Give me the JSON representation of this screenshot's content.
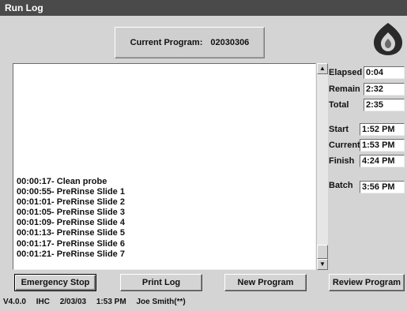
{
  "window": {
    "title": "Run Log"
  },
  "program": {
    "label": "Current Program:",
    "value": "02030306"
  },
  "logo": {
    "icon": "flame-logo-icon"
  },
  "log": {
    "lines": [
      "00:00:17- Clean probe",
      "00:00:55- PreRinse Slide 1",
      "00:01:01- PreRinse Slide 2",
      "00:01:05- PreRinse Slide 3",
      "00:01:09- PreRinse Slide 4",
      "00:01:13- PreRinse Slide 5",
      "00:01:17- PreRinse Slide 6",
      "00:01:21- PreRinse Slide 7"
    ]
  },
  "timing": {
    "elapsed": {
      "label": "Elapsed",
      "value": "0:04"
    },
    "remain": {
      "label": "Remain",
      "value": "2:32"
    },
    "total": {
      "label": "Total",
      "value": "2:35"
    },
    "start": {
      "label": "Start",
      "value": "1:52 PM"
    },
    "current": {
      "label": "Current",
      "value": "1:53 PM"
    },
    "finish": {
      "label": "Finish",
      "value": "4:24 PM"
    },
    "batch": {
      "label": "Batch",
      "value": "3:56 PM"
    }
  },
  "buttons": {
    "emergency_stop": "Emergency Stop",
    "print_log": "Print Log",
    "new_program": "New Program",
    "review_program": "Review Program"
  },
  "status": {
    "version": "V4.0.0",
    "mode": "IHC",
    "date": "2/03/03",
    "time": "1:53 PM",
    "user": "Joe Smith(**)"
  }
}
